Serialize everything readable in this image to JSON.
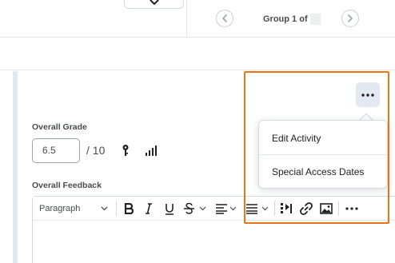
{
  "header": {
    "group_label": "Group 1 of",
    "prev_icon": "chevron-left-icon",
    "next_icon": "chevron-right-icon",
    "dropdown_icon": "chevron-down-icon"
  },
  "grade": {
    "label": "Overall Grade",
    "value": "6.5",
    "max": "/ 10",
    "key_icon": "key-icon",
    "stats_icon": "stats-icon"
  },
  "feedback": {
    "label": "Overall Feedback",
    "toolbar": {
      "paragraph_label": "Paragraph",
      "buttons": [
        "bold-icon",
        "italic-icon",
        "underline-icon",
        "strikethrough-icon",
        "align-icon",
        "list-icon",
        "insert-media-icon",
        "link-icon",
        "image-icon",
        "more-icon"
      ]
    }
  },
  "more_menu": {
    "icon": "more-horizontal-icon",
    "items": [
      {
        "label": "Edit Activity"
      },
      {
        "label": "Special Access Dates"
      }
    ]
  },
  "colors": {
    "highlight": "#e87511",
    "accent_panel": "#e3e9f1",
    "text_dark": "#202122",
    "text_muted": "#494c4e"
  }
}
